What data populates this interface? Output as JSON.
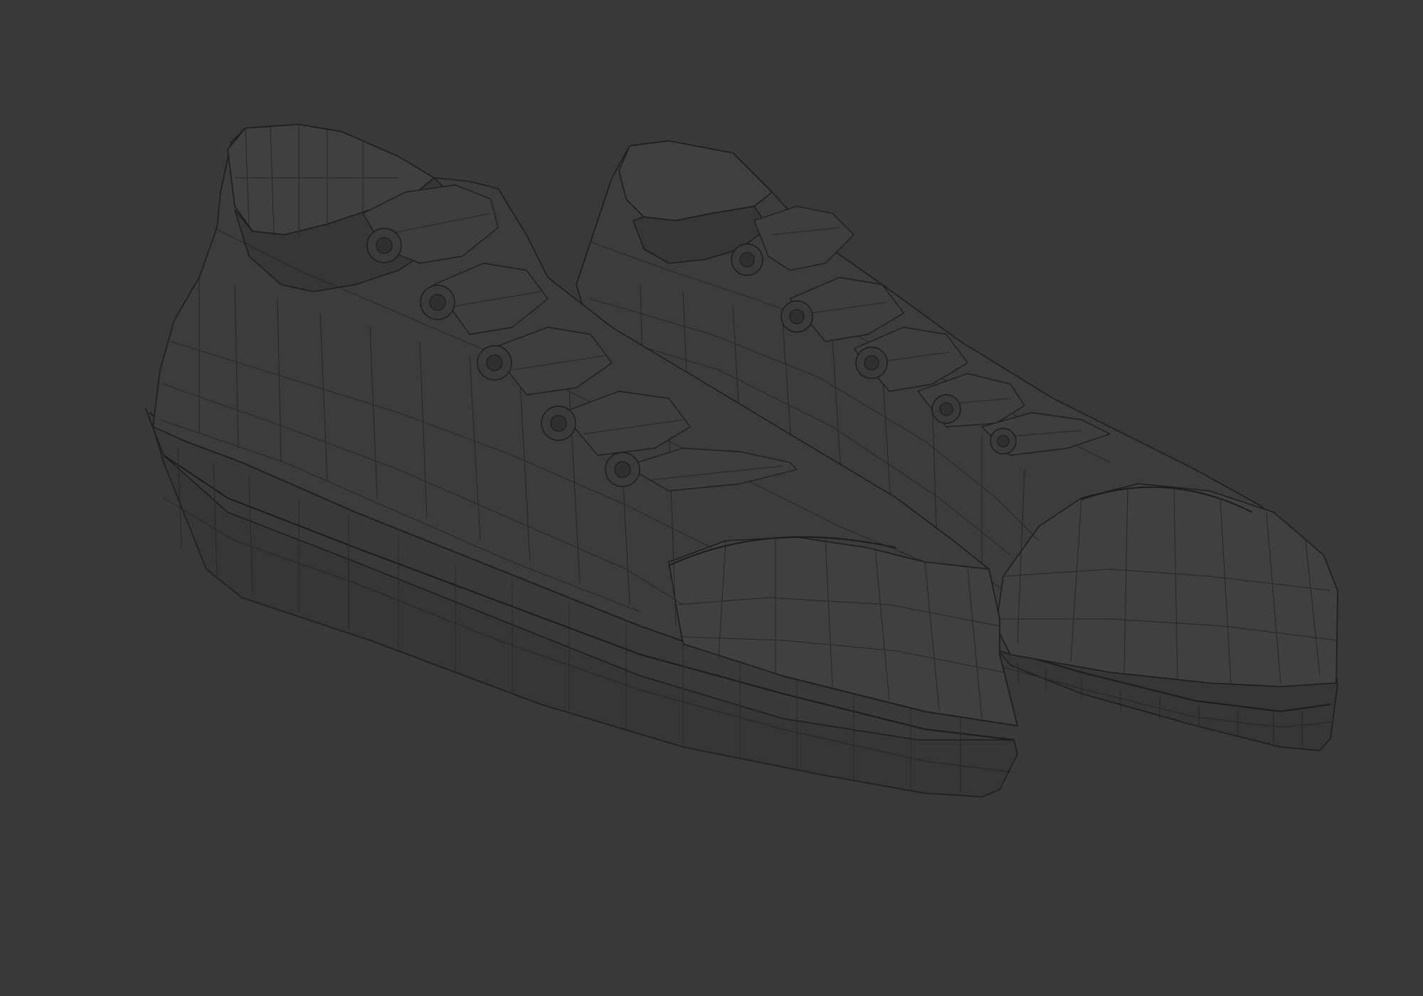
{
  "viewport": {
    "background_color": "#393939",
    "wire_color": "#262626",
    "shade_mode": "wireframe-overlay"
  },
  "scene": {
    "objects": [
      {
        "name": "sneaker-left",
        "eyelets": 5
      },
      {
        "name": "sneaker-right",
        "eyelets": 5
      }
    ]
  }
}
